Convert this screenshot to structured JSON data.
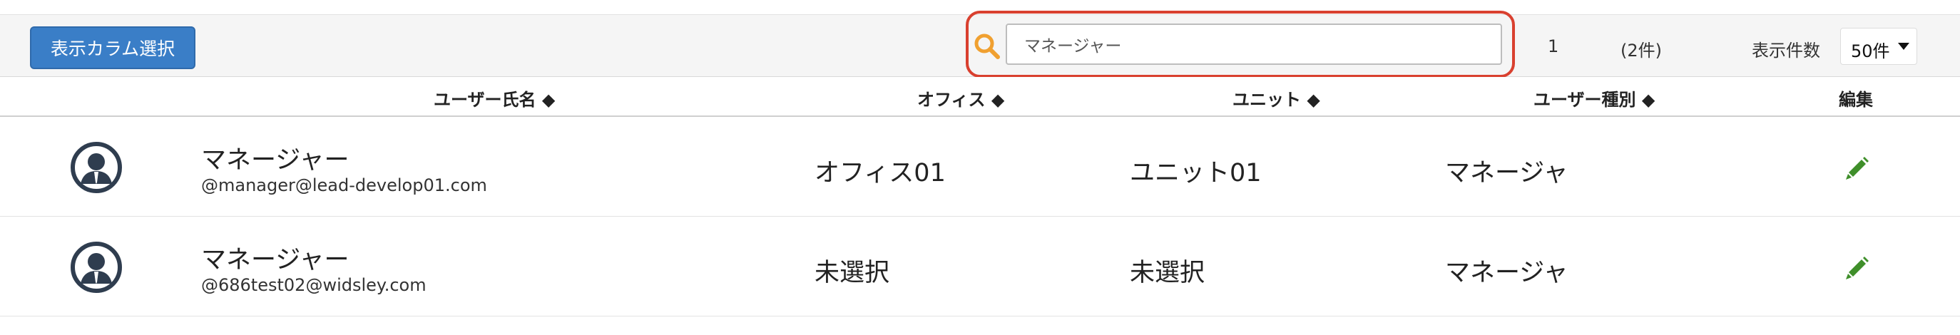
{
  "toolbar": {
    "column_select_label": "表示カラム選択",
    "search": {
      "value": "マネージャー",
      "placeholder": ""
    },
    "page_number": "1",
    "result_count": "(2件)",
    "per_page_label": "表示件数",
    "per_page_value": "50件"
  },
  "table": {
    "headers": {
      "name": "ユーザー氏名 ◆",
      "office": "オフィス ◆",
      "unit": "ユニット ◆",
      "user_type": "ユーザー種別 ◆",
      "edit": "編集"
    },
    "rows": [
      {
        "name": "マネージャー",
        "email": "@manager@lead-develop01.com",
        "office": "オフィス01",
        "unit": "ユニット01",
        "user_type": "マネージャ"
      },
      {
        "name": "マネージャー",
        "email": "@686test02@widsley.com",
        "office": "未選択",
        "unit": "未選択",
        "user_type": "マネージャ"
      }
    ]
  },
  "icons": {
    "search": "search-icon",
    "avatar": "user-avatar-icon",
    "edit": "pencil-icon",
    "dropdown": "chevron-down-icon"
  },
  "colors": {
    "primary_button": "#3a7ec7",
    "search_highlight": "#d9402f",
    "search_icon": "#f0a030",
    "edit_icon": "#3f8f2a",
    "avatar": "#2f3d4f"
  }
}
